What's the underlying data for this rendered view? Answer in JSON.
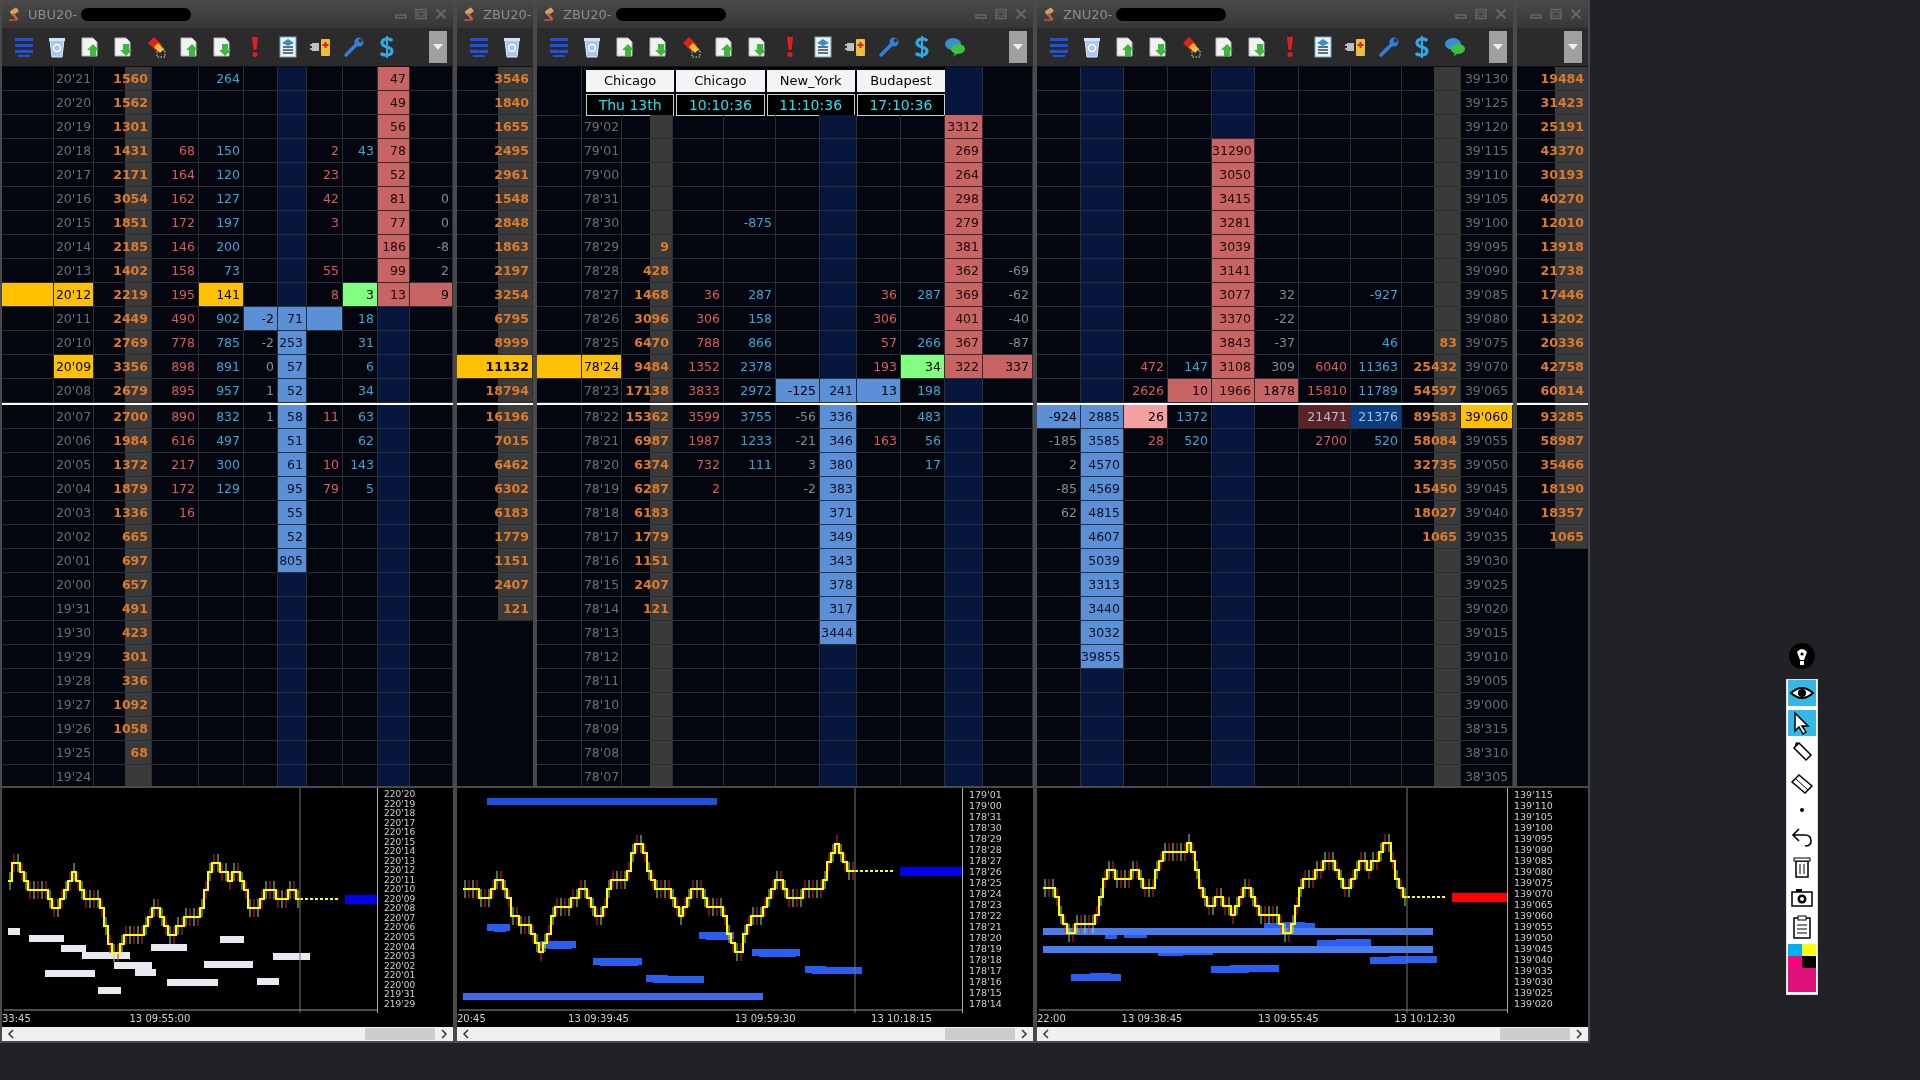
{
  "windows": [
    {
      "title": "UBU20-",
      "redacted": true,
      "title_buttons": true,
      "toolbar": {
        "kind": "standard"
      },
      "rows_above": [
        {
          "price": "20'21",
          "volume": "1560",
          "column_5": "264",
          "column_10": "47"
        },
        {
          "price": "20'20",
          "volume": "1562",
          "column_10": "49"
        },
        {
          "price": "20'19",
          "volume": "1301",
          "column_10": "56"
        },
        {
          "price": "20'18",
          "volume": "1431",
          "column_4": "68",
          "column_5": "150",
          "column_8": "2",
          "column_9": "43",
          "column_10": "78"
        },
        {
          "price": "20'17",
          "volume": "2171",
          "column_4": "164",
          "column_5": "120",
          "column_8": "23",
          "column_10": "52"
        },
        {
          "price": "20'16",
          "volume": "3054",
          "column_4": "162",
          "column_5": "127",
          "column_8": "42",
          "column_10": "81",
          "column_11": "0"
        },
        {
          "price": "20'15",
          "volume": "1851",
          "column_4": "172",
          "column_5": "197",
          "column_8": "3",
          "column_10": "77",
          "column_11": "0"
        },
        {
          "price": "20'14",
          "volume": "2185",
          "column_4": "146",
          "column_5": "200",
          "column_10": "186",
          "column_11": "-8"
        },
        {
          "price": "20'13",
          "volume": "1402",
          "column_4": "158",
          "column_5": "73",
          "column_8": "55",
          "column_10": "99",
          "column_11": "2"
        },
        {
          "column_1": {
            "color": "#ffc000"
          },
          "price": {
            "text": "20'12",
            "color": "#ffc000"
          },
          "volume": "2219",
          "column_4": "195",
          "column_5": {
            "text": "141",
            "color": "#ffc000"
          },
          "column_8": "8",
          "column_9": {
            "text": "3",
            "color": "#80ff80"
          },
          "column_10": "13",
          "column_11": {
            "text": "9",
            "color": "#c86464"
          }
        },
        {
          "price": "20'11",
          "volume": "2449",
          "column_4": "490",
          "column_5": "902",
          "column_6": {
            "text": "-2",
            "color": "#5b8fd6"
          },
          "column_7": "71",
          "column_8": {
            "color": "#5b8fd6"
          },
          "column_9": "18"
        },
        {
          "price": "20'10",
          "volume": "2769",
          "column_4": "778",
          "column_5": "785",
          "column_6": "-2",
          "column_7": "253",
          "column_9": "31"
        },
        {
          "price": {
            "text": "20'09",
            "color": "#ffc000"
          },
          "volume": "3356",
          "column_4": "898",
          "column_5": "891",
          "column_6": "0",
          "column_7": "57",
          "column_9": "6"
        },
        {
          "price": "20'08",
          "volume": "2679",
          "column_4": "895",
          "column_5": "957",
          "column_6": "1",
          "column_7": "52",
          "column_9": "34"
        }
      ],
      "rows_below": [
        {
          "price": "20'07",
          "volume": "2700",
          "column_4": "890",
          "column_5": "832",
          "column_6": "1",
          "column_7": "58",
          "column_8": "11",
          "column_9": "63"
        },
        {
          "price": "20'06",
          "volume": "1984",
          "column_4": "616",
          "column_5": "497",
          "column_7": "51",
          "column_9": "62"
        },
        {
          "price": "20'05",
          "volume": "1372",
          "column_4": "217",
          "column_5": "300",
          "column_7": "61",
          "column_8": "10",
          "column_9": "143"
        },
        {
          "price": "20'04",
          "volume": "1879",
          "column_4": "172",
          "column_5": "129",
          "column_7": "95",
          "column_8": "79",
          "column_9": "5"
        },
        {
          "price": "20'03",
          "volume": "1336",
          "column_4": "16",
          "column_7": "55"
        },
        {
          "price": "20'02",
          "volume": "665",
          "column_7": "52"
        },
        {
          "price": "20'01",
          "volume": "697",
          "column_7": "805"
        },
        {
          "price": "20'00",
          "volume": "657"
        },
        {
          "price": "19'31",
          "volume": "491"
        },
        {
          "price": "19'30",
          "volume": "423"
        },
        {
          "price": "19'29",
          "volume": "301"
        },
        {
          "price": "19'28",
          "volume": "336"
        },
        {
          "price": "19'27",
          "volume": "1092"
        },
        {
          "price": "19'26",
          "volume": "1058"
        },
        {
          "price": "19'25",
          "volume": "68"
        },
        {
          "price": "19'24"
        }
      ]
    },
    {
      "title": "ZBU20-",
      "redacted": false,
      "title_buttons": false,
      "toolbar": {
        "kind": "clipped"
      },
      "rows_above": [
        {
          "volume": "3546"
        },
        {
          "volume": "1840"
        },
        {
          "volume": "1655"
        },
        {
          "volume": "2495"
        },
        {
          "volume": "2961"
        },
        {
          "volume": "1548"
        },
        {
          "volume": "2848"
        },
        {
          "volume": "1863"
        },
        {
          "volume": "2197"
        },
        {
          "volume": "3254"
        },
        {
          "volume": "6795"
        },
        {
          "volume": "8999"
        },
        {
          "volume": {
            "text": "11132",
            "color": "#ffc000"
          }
        },
        {
          "volume": "18794"
        }
      ],
      "rows_below": [
        {
          "volume": "16196"
        },
        {
          "volume": "7015"
        },
        {
          "volume": "6462"
        },
        {
          "volume": "6302"
        },
        {
          "volume": "6183"
        },
        {
          "volume": "1779"
        },
        {
          "volume": "1151"
        },
        {
          "volume": "2407"
        },
        {
          "volume": "121"
        }
      ]
    },
    {
      "title": "ZBU20-",
      "redacted": true,
      "title_buttons": true,
      "toolbar": {
        "kind": "extended"
      },
      "clock": [
        {
          "city": "Chicago",
          "time": "Thu 13th"
        },
        {
          "city": "Chicago",
          "time": "10:10:36"
        },
        {
          "city": "New_York",
          "time": "11:10:36"
        },
        {
          "city": "Budapest",
          "time": "17:10:36"
        }
      ],
      "rows_above": [
        {
          "price": "79'02",
          "column_10": "3312"
        },
        {
          "price": "79'01",
          "column_10": "269"
        },
        {
          "price": "79'00",
          "column_10": "264"
        },
        {
          "price": "78'31",
          "column_10": "298"
        },
        {
          "price": "78'30",
          "column_5": "-875",
          "column_10": "279"
        },
        {
          "price": "78'29",
          "volume": "9",
          "column_10": "381"
        },
        {
          "price": "78'28",
          "volume": "428",
          "column_10": "362",
          "column_11": "-69"
        },
        {
          "price": "78'27",
          "volume": "1468",
          "column_4": "36",
          "column_5": "287",
          "column_8": "36",
          "column_9": "287",
          "column_10": "369",
          "column_11": "-62"
        },
        {
          "price": "78'26",
          "volume": "3096",
          "column_4": "306",
          "column_5": "158",
          "column_8": "306",
          "column_10": "401",
          "column_11": "-40"
        },
        {
          "price": "78'25",
          "volume": "6470",
          "column_4": "788",
          "column_5": "866",
          "column_8": "57",
          "column_9": "266",
          "column_10": "367",
          "column_11": "-87"
        },
        {
          "column_1": {
            "color": "#ffc000"
          },
          "price": {
            "text": "78'24",
            "color": "#ffc000"
          },
          "volume": "9484",
          "column_4": "1352",
          "column_5": "2378",
          "column_8": "193",
          "column_9": {
            "text": "34",
            "color": "#80ff80"
          },
          "column_10": "322",
          "column_11": {
            "text": "337",
            "color": "#c86464"
          }
        },
        {
          "price": "78'23",
          "volume": "17138",
          "column_4": "3833",
          "column_5": "2972",
          "column_6": {
            "text": "-125",
            "color": "#5b8fd6"
          },
          "column_7": "241",
          "column_8": {
            "text": "13",
            "color": "#5b8fd6"
          },
          "column_9": "198"
        }
      ],
      "rows_below": [
        {
          "price": "78'22",
          "volume": "15362",
          "column_4": "3599",
          "column_5": "3755",
          "column_6": "-56",
          "column_7": "336",
          "column_9": "483"
        },
        {
          "price": "78'21",
          "volume": "6987",
          "column_4": "1987",
          "column_5": "1233",
          "column_6": "-21",
          "column_7": "346",
          "column_8": "163",
          "column_9": "56"
        },
        {
          "price": "78'20",
          "volume": "6374",
          "column_4": "732",
          "column_5": "111",
          "column_6": "3",
          "column_7": "380",
          "column_9": "17"
        },
        {
          "price": "78'19",
          "volume": "6287",
          "column_4": "2",
          "column_6": "-2",
          "column_7": "383"
        },
        {
          "price": "78'18",
          "volume": "6183",
          "column_7": "371"
        },
        {
          "price": "78'17",
          "volume": "1779",
          "column_7": "349"
        },
        {
          "price": "78'16",
          "volume": "1151",
          "column_7": "343"
        },
        {
          "price": "78'15",
          "volume": "2407",
          "column_7": "378"
        },
        {
          "price": "78'14",
          "volume": "121",
          "column_7": "317"
        },
        {
          "price": "78'13",
          "column_7": "3444"
        },
        {
          "price": "78'12"
        },
        {
          "price": "78'11"
        },
        {
          "price": "78'10"
        },
        {
          "price": "78'09"
        },
        {
          "price": "78'08"
        },
        {
          "price": "78'07"
        }
      ]
    },
    {
      "title": "ZNU20-",
      "redacted": true,
      "title_buttons": true,
      "toolbar": {
        "kind": "extended"
      },
      "rows_above": [
        {
          "price": "39'130"
        },
        {
          "price": "39'125"
        },
        {
          "price": "39'120"
        },
        {
          "column_5": "31290",
          "price": "39'115"
        },
        {
          "column_5": "3050",
          "price": "39'110"
        },
        {
          "column_5": "3415",
          "price": "39'105"
        },
        {
          "column_5": "3281",
          "price": "39'100"
        },
        {
          "column_5": "3039",
          "price": "39'095"
        },
        {
          "column_5": "3141",
          "price": "39'090"
        },
        {
          "column_5": "3077",
          "column_6": "32",
          "column_8": "-927",
          "price": "39'085"
        },
        {
          "column_5": "3370",
          "column_6": "-22",
          "price": "39'080"
        },
        {
          "column_5": "3843",
          "column_6": "-37",
          "column_8": "46",
          "volume": "83",
          "price": "39'075"
        },
        {
          "column_3": "472",
          "column_4": "147",
          "column_5": "3108",
          "column_6": "309",
          "column_7": "6040",
          "column_8": "11363",
          "volume": "25432",
          "price": "39'070"
        },
        {
          "column_3": "2626",
          "column_4": {
            "text": "10",
            "color": "#c86464"
          },
          "column_5": "1966",
          "column_6": {
            "text": "1878",
            "color": "#c86464"
          },
          "column_7": "15810",
          "column_8": "11789",
          "volume": "54597",
          "price": "39'065"
        }
      ],
      "rows_below": [
        {
          "column_1": {
            "text": "-924",
            "color": "#5b8fd6"
          },
          "column_2": "2885",
          "column_3": {
            "text": "26",
            "color": "#f4a0a0"
          },
          "column_4": "1372",
          "column_7": {
            "text": "21471",
            "color": "#5a2222"
          },
          "column_8": {
            "text": "21376",
            "color": "#0c3c80"
          },
          "volume": "89583",
          "price": {
            "text": "39'060",
            "color": "#ffc000"
          }
        },
        {
          "column_1": "-185",
          "column_2": "3585",
          "column_3": "28",
          "column_4": "520",
          "column_7": "2700",
          "column_8": "520",
          "volume": "58084",
          "price": "39'055"
        },
        {
          "column_1": "2",
          "column_2": "4570",
          "volume": "32735",
          "price": "39'050"
        },
        {
          "column_1": "-85",
          "column_2": "4569",
          "volume": "15450",
          "price": "39'045"
        },
        {
          "column_1": "62",
          "column_2": "4815",
          "volume": "18027",
          "price": "39'040"
        },
        {
          "column_2": "4607",
          "volume": "1065",
          "price": "39'035"
        },
        {
          "column_2": "5039",
          "price": "39'030"
        },
        {
          "column_2": "3313",
          "price": "39'025"
        },
        {
          "column_2": "3440",
          "price": "39'020"
        },
        {
          "column_2": "3032",
          "price": "39'015"
        },
        {
          "column_2": "39855",
          "price": "39'010"
        },
        {
          "price": "39'005"
        },
        {
          "price": "39'000"
        },
        {
          "price": "38'315"
        },
        {
          "price": "38'310"
        },
        {
          "price": "38'305"
        }
      ]
    },
    {
      "redacted": false,
      "title_buttons": true,
      "toolbar": {
        "kind": "edge"
      },
      "rows_above": [
        {
          "volume": "19484"
        },
        {
          "volume": "31423"
        },
        {
          "volume": "25191"
        },
        {
          "volume": "43370"
        },
        {
          "volume": "30193"
        },
        {
          "volume": "40270"
        },
        {
          "volume": "12010"
        },
        {
          "volume": "13918"
        },
        {
          "volume": "21738"
        },
        {
          "volume": "17446"
        },
        {
          "volume": "13202"
        },
        {
          "volume": "20336"
        },
        {
          "volume": "42758"
        },
        {
          "volume": "60814"
        }
      ],
      "rows_below": [
        {
          "volume": "93285"
        },
        {
          "volume": "58987"
        },
        {
          "volume": "35466"
        },
        {
          "volume": "18190"
        },
        {
          "volume": "18357"
        },
        {
          "volume": "1065"
        }
      ]
    }
  ],
  "charts": [
    {
      "y_labels": [
        "220'20",
        "220'19",
        "220'18",
        "220'17",
        "220'16",
        "220'15",
        "220'14",
        "220'13",
        "220'12",
        "220'11",
        "220'10",
        "220'09",
        "220'08",
        "220'07",
        "220'06",
        "220'05",
        "220'04",
        "220'03",
        "220'02",
        "220'01",
        "220'00",
        "219'31",
        "219'29"
      ],
      "x_labels": [
        "33:45",
        "13 09:55:00"
      ]
    },
    {
      "y_labels": [
        "179'01",
        "179'00",
        "178'31",
        "178'30",
        "178'29",
        "178'28",
        "178'27",
        "178'26",
        "178'25",
        "178'24",
        "178'23",
        "178'22",
        "178'21",
        "178'20",
        "178'19",
        "178'18",
        "178'17",
        "178'16",
        "178'15",
        "178'14"
      ],
      "x_labels": [
        "20:45",
        "13 09:39:45",
        "13 09:59:30",
        "13 10:18:15"
      ]
    },
    {
      "y_labels": [
        "139'115",
        "139'110",
        "139'105",
        "139'100",
        "139'095",
        "139'090",
        "139'085",
        "139'080",
        "139'075",
        "139'070",
        "139'065",
        "139'060",
        "139'055",
        "139'050",
        "139'045",
        "139'040",
        "139'035",
        "139'030",
        "139'025",
        "139'020"
      ],
      "x_labels": [
        "22:00",
        "13 09:38:45",
        "13 09:55:45",
        "13 10:12:30"
      ]
    }
  ]
}
